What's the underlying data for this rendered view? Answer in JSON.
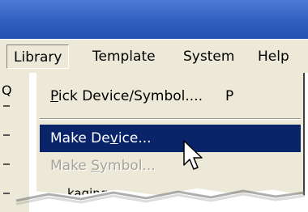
{
  "menubar": {
    "items": [
      {
        "label": "Library",
        "active": true
      },
      {
        "label": "Template"
      },
      {
        "label": "System"
      },
      {
        "label": "Help"
      }
    ]
  },
  "left_frame": {
    "stub": "Q"
  },
  "dropdown": {
    "items": [
      {
        "pre": "",
        "accel": "P",
        "post": "ick Device/Symbol....",
        "shortcut": "P",
        "state": "normal"
      },
      {
        "pre": "Make De",
        "accel": "v",
        "post": "ice...",
        "shortcut": "",
        "state": "selected"
      },
      {
        "pre": "Make ",
        "accel": "S",
        "post": "ymbol...",
        "shortcut": "",
        "state": "disabled"
      },
      {
        "pre": "",
        "accel": "",
        "post": "kaging",
        "shortcut": "",
        "state": "normal"
      }
    ]
  },
  "colors": {
    "titlebar": "#2f5fbf",
    "menu_background": "#ece9d8",
    "selection_highlight": "#0a246a",
    "disabled_text": "#a6a39a"
  },
  "icons": {
    "cursor": "mouse-pointer-icon"
  }
}
